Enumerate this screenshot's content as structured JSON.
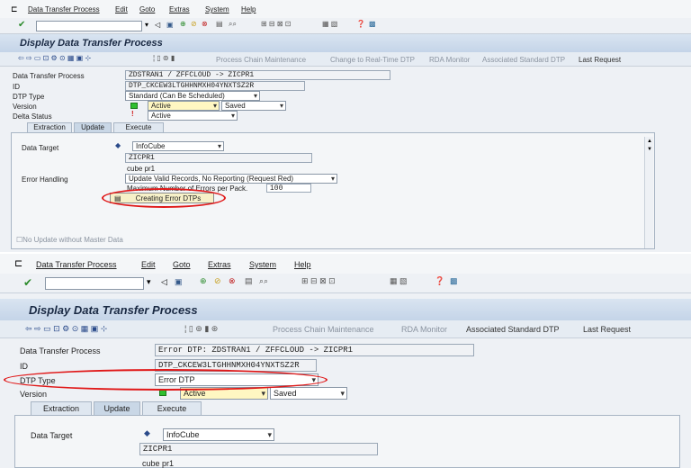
{
  "top": {
    "menu": [
      "Data Transfer Process",
      "Edit",
      "Goto",
      "Extras",
      "System",
      "Help"
    ],
    "title": "Display Data Transfer Process",
    "app_toolbar": [
      "Process Chain Maintenance",
      "Change to Real-Time DTP",
      "RDA Monitor",
      "Associated Standard DTP",
      "Last Request"
    ],
    "fields": {
      "dtp_label": "Data Transfer Process",
      "dtp_value": "ZDSTRAN1 / ZFFCLOUD -> ZICPR1",
      "id_label": "ID",
      "id_value": "DTP_CKCEW3LTGHHNMXH04YNXTSZ2R",
      "type_label": "DTP Type",
      "type_value": "Standard (Can Be Scheduled)",
      "version_label": "Version",
      "version_value": "Active",
      "version_status": "Saved",
      "delta_label": "Delta Status",
      "delta_value": "Active"
    },
    "tabs": [
      "Extraction",
      "Update",
      "Execute"
    ],
    "update": {
      "data_target_label": "Data Target",
      "data_target_type": "InfoCube",
      "target_name": "ZICPR1",
      "target_desc": "cube pr1",
      "error_handling_label": "Error Handling",
      "error_handling_value": "Update Valid Records, No Reporting (Request Red)",
      "max_errors_label": "Maximum Number of Errors per Pack.",
      "max_errors_value": "100",
      "creating_error_btn": "Creating Error DTPs",
      "no_update_label": "No Update without Master Data"
    }
  },
  "bottom": {
    "menu": [
      "Data Transfer Process",
      "Edit",
      "Goto",
      "Extras",
      "System",
      "Help"
    ],
    "title": "Display Data Transfer Process",
    "app_toolbar": [
      "Process Chain Maintenance",
      "RDA Monitor",
      "Associated Standard DTP",
      "Last Request"
    ],
    "fields": {
      "dtp_label": "Data Transfer Process",
      "dtp_value": "Error DTP: ZDSTRAN1 / ZFFCLOUD -> ZICPR1",
      "id_label": "ID",
      "id_value": "DTP_CKCEW3LTGHHNMXH04YNXTSZ2R",
      "type_label": "DTP Type",
      "type_value": "Error DTP",
      "version_label": "Version",
      "version_value": "Active",
      "version_status": "Saved"
    },
    "tabs": [
      "Extraction",
      "Update",
      "Execute"
    ],
    "update": {
      "data_target_label": "Data Target",
      "data_target_type": "InfoCube",
      "target_name": "ZICPR1",
      "target_desc": "cube pr1"
    }
  },
  "colors": {
    "highlight": "#e01818",
    "title_bar": "#c4d4e8",
    "status_green": "#2fbf2f"
  }
}
